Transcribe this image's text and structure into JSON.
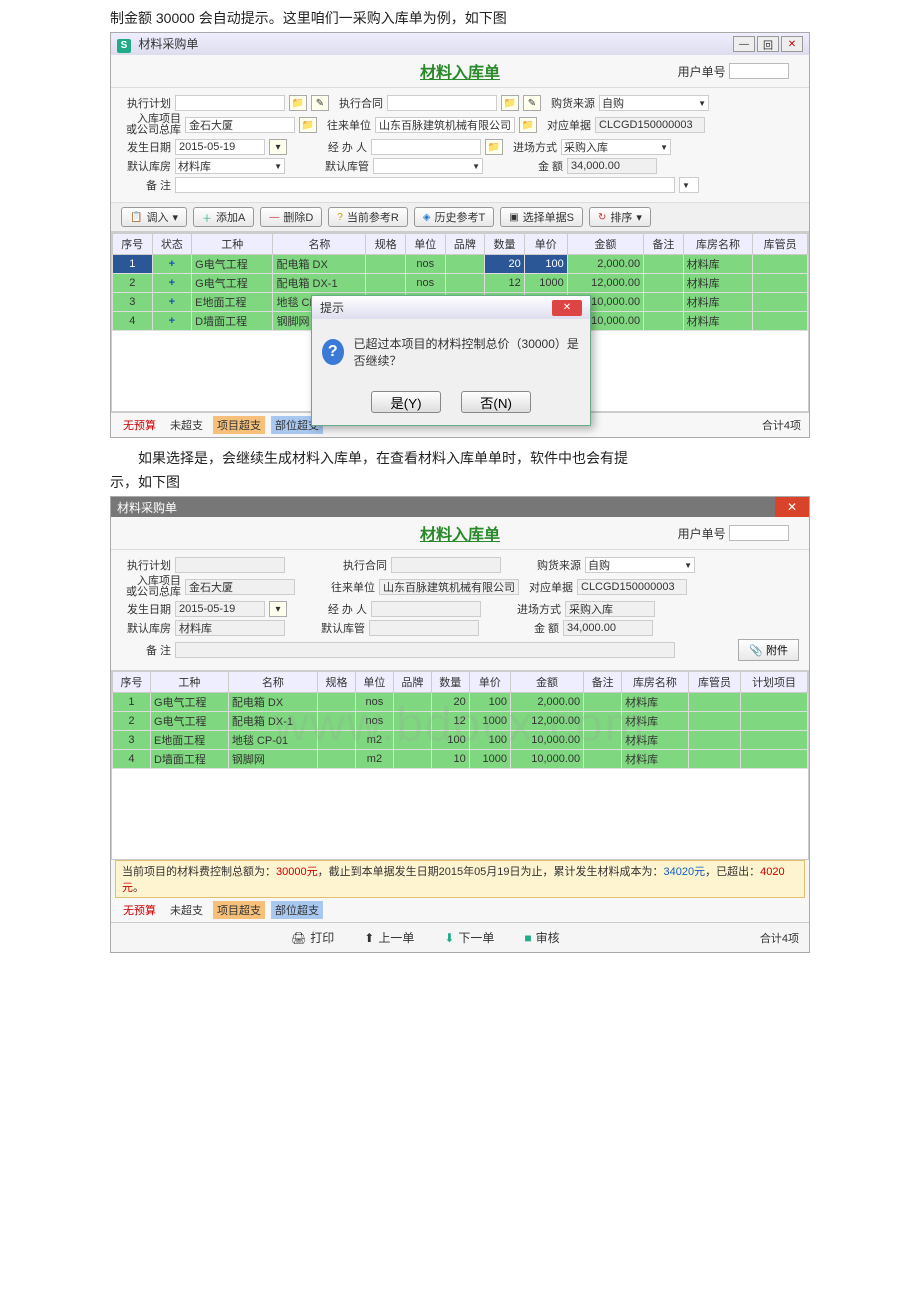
{
  "doc": {
    "line1": "制金额 30000 会自动提示。这里咱们一采购入库单为例，如下图",
    "line2": "如果选择是，会继续生成材料入库单，在查看材料入库单单时，软件中也会有提",
    "line3": "示，如下图"
  },
  "page_title": "材料入库单",
  "user_no_label": "用户单号",
  "window1": {
    "title": "材料采购单",
    "win_buttons": {
      "min": "—",
      "max": "回",
      "close": "✕"
    }
  },
  "form": {
    "exec_plan_label": "执行计划",
    "exec_contract_label": "执行合同",
    "source_label": "购货来源",
    "source_value": "自购",
    "proj_label": "入库项目\n或公司总库",
    "proj_value": "金石大厦",
    "vendor_label": "往来单位",
    "vendor_value": "山东百脉建筑机械有限公司",
    "doc_no_label": "对应单据",
    "doc_no_value": "CLCGD150000003",
    "date_label": "发生日期",
    "date_value": "2015-05-19",
    "handler_label": "经 办 人",
    "mode_label": "进场方式",
    "mode_value": "采购入库",
    "default_store_label": "默认库房",
    "default_store_value": "材料库",
    "default_keeper_label": "默认库管",
    "amount_label": "金    额",
    "amount_value": "34,000.00",
    "remark_label": "备    注",
    "attach_label": "📎 附件"
  },
  "toolbar": {
    "import_label": "调入",
    "add_label": "添加A",
    "delete_label": "删除D",
    "cur_ref_label": "当前参考R",
    "hist_ref_label": "历史参考T",
    "select_doc_label": "选择单据S",
    "sort_label": "排序"
  },
  "table": {
    "headers": {
      "seq": "序号",
      "status": "状态",
      "work": "工种",
      "name": "名称",
      "spec": "规格",
      "unit": "单位",
      "brand": "品牌",
      "qty": "数量",
      "price": "单价",
      "amount": "金额",
      "remark": "备注",
      "store": "库房名称",
      "keeper": "库管员",
      "plan_item": "计划项目"
    },
    "rows": [
      {
        "seq": "1",
        "status": "+",
        "work": "G电气工程",
        "name": "配电箱 DX",
        "spec": "",
        "unit": "nos",
        "brand": "",
        "qty": "20",
        "price": "100",
        "amount": "2,000.00",
        "remark": "",
        "store": "材料库",
        "keeper": ""
      },
      {
        "seq": "2",
        "status": "+",
        "work": "G电气工程",
        "name": "配电箱 DX-1",
        "spec": "",
        "unit": "nos",
        "brand": "",
        "qty": "12",
        "price": "1000",
        "amount": "12,000.00",
        "remark": "",
        "store": "材料库",
        "keeper": ""
      },
      {
        "seq": "3",
        "status": "+",
        "work": "E地面工程",
        "name": "地毯 CP-01",
        "spec": "",
        "unit": "m2",
        "brand": "",
        "qty": "100",
        "price": "100",
        "amount": "10,000.00",
        "remark": "",
        "store": "材料库",
        "keeper": ""
      },
      {
        "seq": "4",
        "status": "+",
        "work": "D墙面工程",
        "name": "钢脚网",
        "spec": "",
        "unit": "m2",
        "brand": "",
        "qty": "10",
        "price": "1000",
        "amount": "10,000.00",
        "remark": "",
        "store": "材料库",
        "keeper": ""
      }
    ]
  },
  "dialog": {
    "title": "提示",
    "message": "已超过本项目的材料控制总价（30000）是否继续？",
    "yes": "是(Y)",
    "no": "否(N)"
  },
  "legend": {
    "no_budget": "无预算",
    "not_over": "未超支",
    "proj_over": "项目超支",
    "part_over": "部位超支"
  },
  "footer_total": "合计4项",
  "warn_bar": {
    "p1": "当前项目的材料费控制总额为：",
    "v1": "30000元",
    "p2": "，截止到本单据发生日期2015年05月19日为止，累计发生材料成本为：",
    "v2": "34020元",
    "p3": "，已超出：",
    "v3": "4020元",
    "p4": "。"
  },
  "bottom_toolbar": {
    "print": "打印",
    "prev": "上一单",
    "next": "下一单",
    "audit": "审核"
  },
  "window2": {
    "title": "材料采购单"
  },
  "watermark": "www.bdocx.com"
}
